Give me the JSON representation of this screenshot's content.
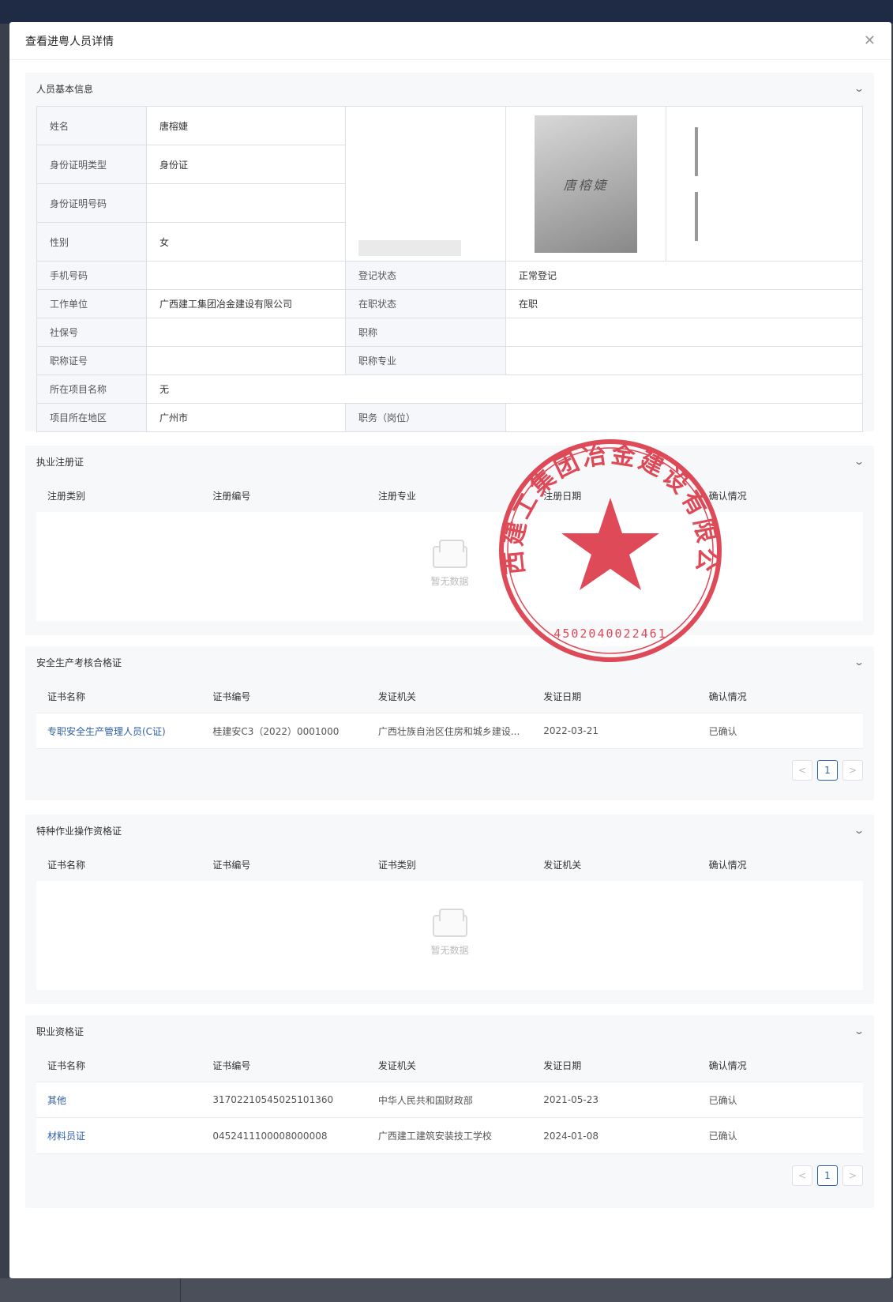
{
  "modal": {
    "title": "查看进粤人员详情"
  },
  "basic": {
    "title": "人员基本信息",
    "name_label": "姓名",
    "name": "唐榕婕",
    "idtype_label": "身份证明类型",
    "idtype": "身份证",
    "idno_label": "身份证明号码",
    "idno": "",
    "gender_label": "性别",
    "gender": "女",
    "phone_label": "手机号码",
    "phone": "",
    "reg_status_label": "登记状态",
    "reg_status": "正常登记",
    "employer_label": "工作单位",
    "employer": "广西建工集团冶金建设有限公司",
    "job_status_label": "在职状态",
    "job_status": "在职",
    "social_label": "社保号",
    "social": "",
    "title_label": "职称",
    "title_val": "",
    "title_cert_label": "职称证号",
    "title_cert": "",
    "title_major_label": "职称专业",
    "title_major": "",
    "project_label": "所在项目名称",
    "project": "无",
    "region_label": "项目所在地区",
    "region": "广州市",
    "position_label": "职务（岗位）",
    "position": "",
    "signature_text": "唐榕婕"
  },
  "registration": {
    "title": "执业注册证",
    "headers": [
      "注册类别",
      "注册编号",
      "注册专业",
      "注册日期",
      "确认情况"
    ],
    "empty_text": "暂无数据"
  },
  "safety": {
    "title": "安全生产考核合格证",
    "headers": [
      "证书名称",
      "证书编号",
      "发证机关",
      "发证日期",
      "确认情况"
    ],
    "rows": [
      [
        "专职安全生产管理人员(C证)",
        "桂建安C3（2022）0001000",
        "广西壮族自治区住房和城乡建设...",
        "2022-03-21",
        "已确认"
      ]
    ],
    "page": "1"
  },
  "special": {
    "title": "特种作业操作资格证",
    "headers": [
      "证书名称",
      "证书编号",
      "证书类别",
      "发证机关",
      "确认情况"
    ],
    "empty_text": "暂无数据"
  },
  "professional": {
    "title": "职业资格证",
    "headers": [
      "证书名称",
      "证书编号",
      "发证机关",
      "发证日期",
      "确认情况"
    ],
    "rows": [
      [
        "其他",
        "31702210545025101360",
        "中华人民共和国财政部",
        "2021-05-23",
        "已确认"
      ],
      [
        "材料员证",
        "0452411100008000008",
        "广西建工建筑安装技工学校",
        "2024-01-08",
        "已确认"
      ]
    ],
    "page": "1"
  },
  "seal": {
    "text": "广西建工集团冶金建设有限公司",
    "code": "4502040022461",
    "color": "#d92b3a"
  },
  "pager": {
    "prev": "<",
    "next": ">"
  },
  "icons": {
    "close": "close-icon",
    "collapse": "chevron-down-icon",
    "empty": "inbox-icon"
  }
}
